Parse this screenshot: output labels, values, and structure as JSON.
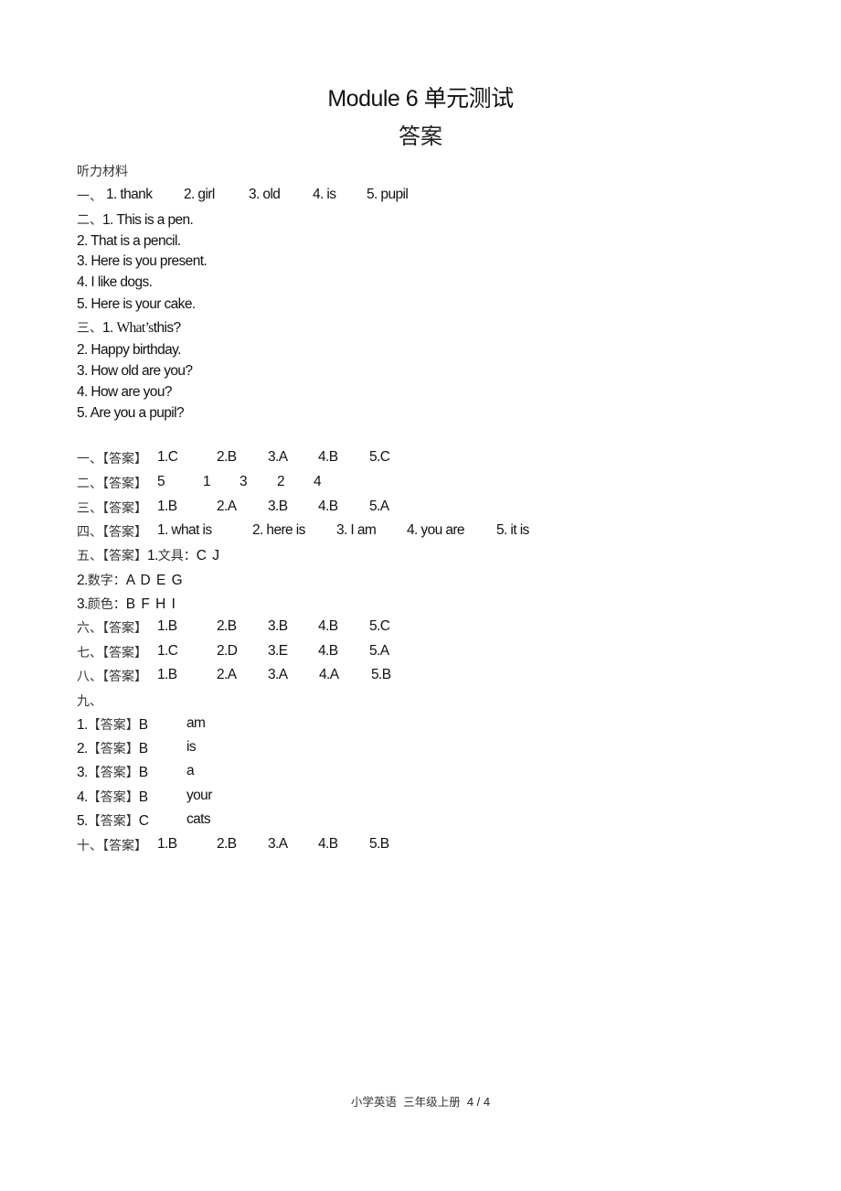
{
  "title": "Module 6 单元测试",
  "subtitle": "答案",
  "listening": {
    "heading": "听力材料",
    "part1": {
      "label": "一、",
      "items": [
        "1. thank",
        "2. girl",
        "3. old",
        "4. is",
        "5. pupil"
      ]
    },
    "part2": {
      "label": "二、",
      "items": [
        "1. This is a pen.",
        "2. That is a pencil.",
        "3. Here is you present.",
        "4. I like dogs.",
        "5. Here is your cake."
      ]
    },
    "part3": {
      "label": "三、",
      "first_num": "1. ",
      "first_serif": "What’s",
      "first_rest": "this?",
      "items": [
        "2. Happy birthday.",
        "3. How old are you?",
        "4. How are you?",
        "5. Are you a pupil?"
      ]
    }
  },
  "answers": {
    "tag": "【答案】",
    "s1": {
      "label": "一、",
      "items": [
        "1.C",
        "2.B",
        "3.A",
        "4.B",
        "5.C"
      ]
    },
    "s2": {
      "label": "二、",
      "items": [
        "5",
        "1",
        "3",
        "2",
        "4"
      ]
    },
    "s3": {
      "label": "三、",
      "items": [
        "1.B",
        "2.A",
        "3.B",
        "4.B",
        "5.A"
      ]
    },
    "s4": {
      "label": "四、",
      "items": [
        "1. what is",
        "2. here is",
        "3. I am",
        "4. you are",
        "5. it is"
      ]
    },
    "s5": {
      "label": "五、",
      "lines": [
        {
          "prefix": "1.",
          "cat": "文具：",
          "letters": "C J"
        },
        {
          "prefix": "2.",
          "cat": "数字：",
          "letters": "A D E G"
        },
        {
          "prefix": "3.",
          "cat": "颜色：",
          "letters": "B F H I"
        }
      ]
    },
    "s6": {
      "label": "六、",
      "items": [
        "1.B",
        "2.B",
        "3.B",
        "4.B",
        "5.C"
      ]
    },
    "s7": {
      "label": "七、",
      "items": [
        "1.C",
        "2.D",
        "3.E",
        "4.B",
        "5.A"
      ]
    },
    "s8": {
      "label": "八、",
      "items": [
        "1.B",
        "2.A",
        "3.A",
        "4.A",
        "5.B"
      ]
    },
    "s9": {
      "label": "九、",
      "items": [
        {
          "num": "1.",
          "choice": "B",
          "word": "am"
        },
        {
          "num": "2.",
          "choice": "B",
          "word": "is"
        },
        {
          "num": "3.",
          "choice": "B",
          "word": "a"
        },
        {
          "num": "4.",
          "choice": "B",
          "word": "your"
        },
        {
          "num": "5.",
          "choice": "C",
          "word": "cats"
        }
      ]
    },
    "s10": {
      "label": "十、",
      "items": [
        "1.B",
        "2.B",
        "3.A",
        "4.B",
        "5.B"
      ]
    }
  },
  "footer": {
    "course": "小学英语",
    "grade": "三年级上册",
    "page": "4 / 4"
  }
}
